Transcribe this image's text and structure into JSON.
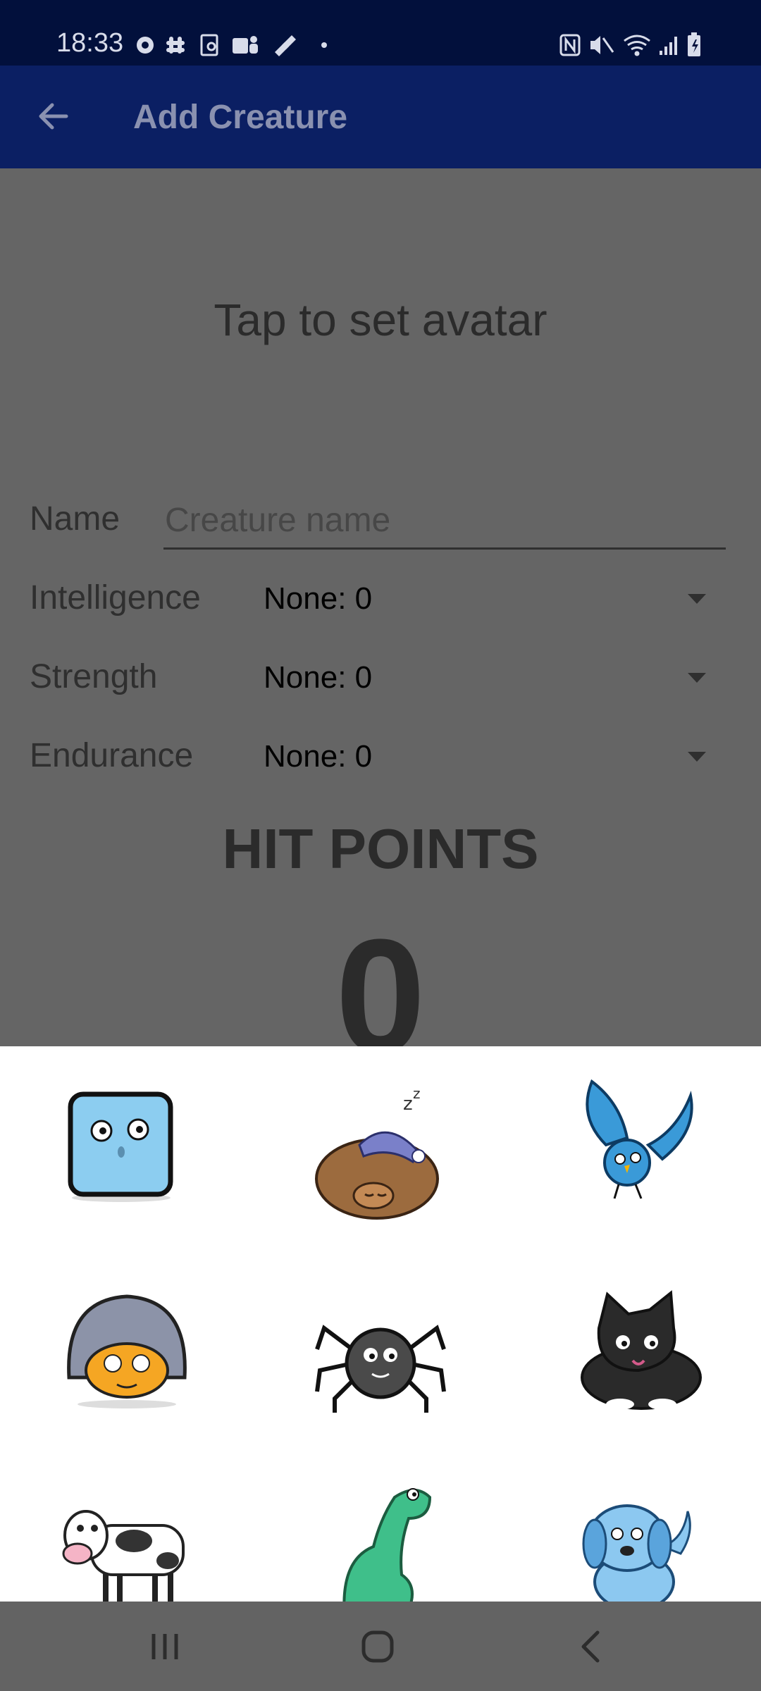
{
  "status_bar": {
    "time": "18:33",
    "left_icons": [
      "settings-icon",
      "slack-icon",
      "screenshot-icon",
      "teams-icon",
      "jira-icon",
      "dot-icon"
    ],
    "right_icons": [
      "nfc-icon",
      "mute-icon",
      "wifi-icon",
      "signal-icon",
      "battery-icon"
    ]
  },
  "app_bar": {
    "title": "Add Creature",
    "back_icon": "arrow-back-icon",
    "color": "#0b1f63"
  },
  "form": {
    "avatar_prompt": "Tap to set avatar",
    "name_label": "Name",
    "name_placeholder": "Creature name",
    "name_value": "",
    "intelligence_label": "Intelligence",
    "intelligence_value": "None: 0",
    "strength_label": "Strength",
    "strength_value": "None: 0",
    "endurance_label": "Endurance",
    "endurance_value": "None: 0",
    "hit_points_label": "HIT POINTS",
    "hit_points_value": "0"
  },
  "avatar_picker": {
    "avatars": [
      "square-face",
      "sleeping-bear",
      "blue-bird",
      "orange-bug",
      "spider",
      "black-cat",
      "cow",
      "green-dinosaur",
      "blue-dog"
    ]
  },
  "nav_bar": {
    "icons": [
      "recent-apps-icon",
      "home-icon",
      "back-icon"
    ]
  }
}
